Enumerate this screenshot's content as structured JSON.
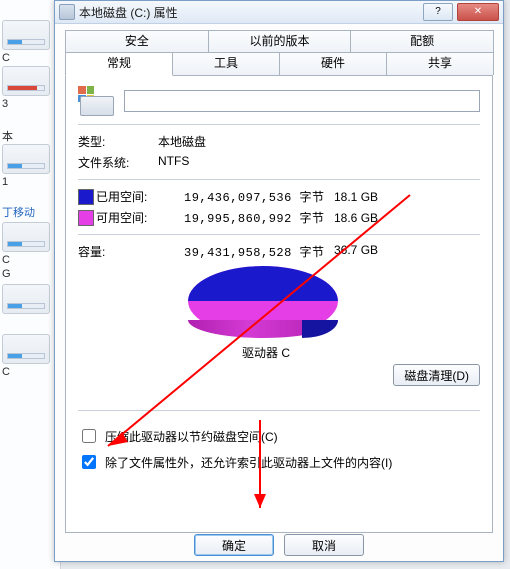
{
  "bg": {
    "label_c": "C",
    "label_3": "3",
    "label_ben": "本",
    "label_1": "1",
    "label_move": "丁移动",
    "label_c2": "C",
    "label_g": "G",
    "label_c3": "C"
  },
  "title": "本地磁盘 (C:) 属性",
  "tabs_row1": [
    "安全",
    "以前的版本",
    "配额"
  ],
  "tabs_row2": [
    "常规",
    "工具",
    "硬件",
    "共享"
  ],
  "active_tab": "常规",
  "name_value": "",
  "type": {
    "label": "类型:",
    "value": "本地磁盘"
  },
  "filesystem": {
    "label": "文件系统:",
    "value": "NTFS"
  },
  "used": {
    "label": "已用空间:",
    "bytes": "19,436,097,536 字节",
    "gb": "18.1 GB"
  },
  "free": {
    "label": "可用空间:",
    "bytes": "19,995,860,992 字节",
    "gb": "18.6 GB"
  },
  "capacity": {
    "label": "容量:",
    "bytes": "39,431,958,528 字节",
    "gb": "36.7 GB"
  },
  "drive_label": "驱动器 C",
  "cleanup_button": "磁盘清理(D)",
  "check_compress": "压缩此驱动器以节约磁盘空间(C)",
  "check_index": "除了文件属性外，还允许索引此驱动器上文件的内容(I)",
  "ok_button": "确定",
  "cancel_button": "取消",
  "chart_data": {
    "type": "pie",
    "title": "驱动器 C",
    "series": [
      {
        "name": "已用空间",
        "value": 19436097536,
        "display": "18.1 GB",
        "color": "#1a1acc"
      },
      {
        "name": "可用空间",
        "value": 19995860992,
        "display": "18.6 GB",
        "color": "#e63ee6"
      }
    ],
    "total": {
      "name": "容量",
      "value": 39431958528,
      "display": "36.7 GB"
    }
  }
}
